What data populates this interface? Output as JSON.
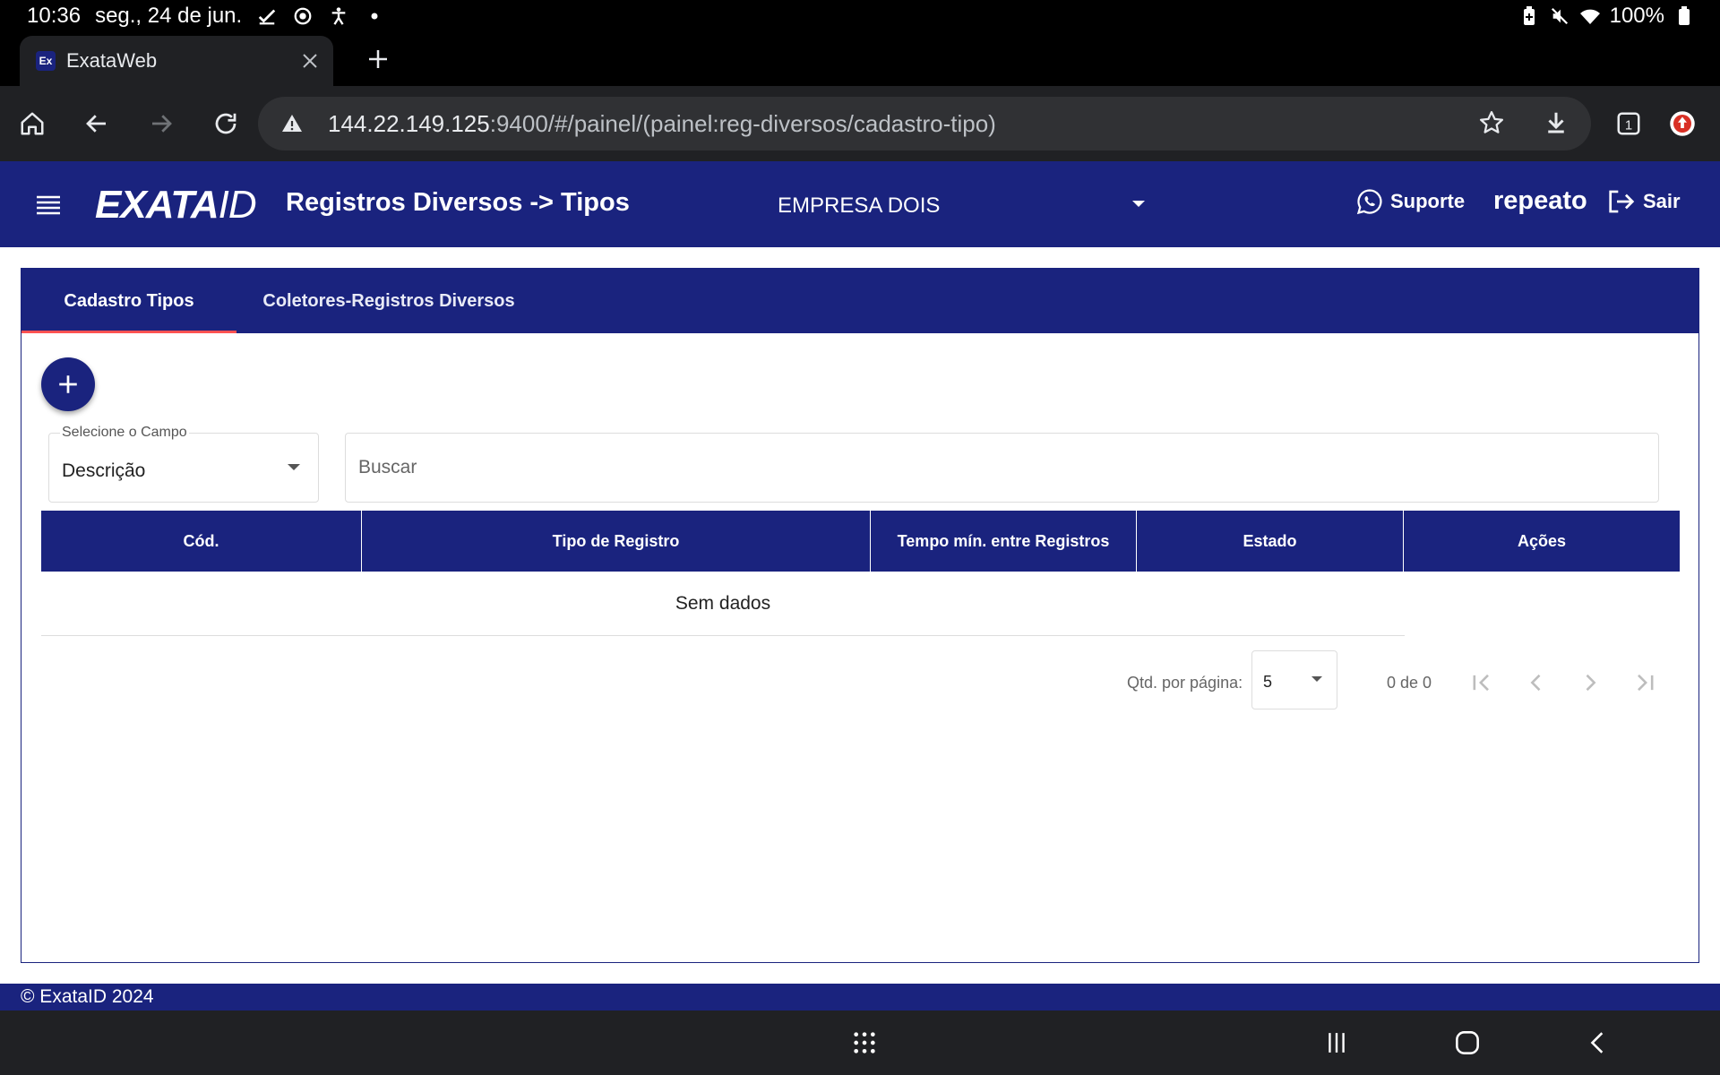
{
  "status_bar": {
    "time": "10:36",
    "date": "seg., 24 de jun.",
    "battery": "100%",
    "icons": [
      "check-icon",
      "radar-icon",
      "accessibility-icon",
      "dot-icon",
      "battery-saver-icon",
      "mute-icon",
      "wifi-icon",
      "battery-icon"
    ]
  },
  "browser": {
    "tab_title": "ExataWeb",
    "favicon_text": "Ex",
    "url_host": "144.22.149.125",
    "url_path": ":9400/#/painel/(painel:reg-diversos/cadastro-tipo)",
    "tab_count": "1"
  },
  "header": {
    "logo_text": "EXATA",
    "logo_suffix": "ID",
    "page_title": "Registros Diversos -> Tipos",
    "company": "EMPRESA DOIS",
    "support_label": "Suporte",
    "username": "repeato",
    "logout_label": "Sair"
  },
  "tabs": [
    {
      "label": "Cadastro Tipos",
      "active": true
    },
    {
      "label": "Coletores-Registros Diversos",
      "active": false
    }
  ],
  "filter": {
    "field_label": "Selecione o Campo",
    "field_value": "Descrição",
    "search_placeholder": "Buscar"
  },
  "table": {
    "columns": [
      "Cód.",
      "Tipo de Registro",
      "Tempo mín. entre Registros",
      "Estado",
      "Ações"
    ],
    "empty_message": "Sem dados"
  },
  "paginator": {
    "per_page_label": "Qtd. por página:",
    "per_page_value": "5",
    "range_label": "0 de 0"
  },
  "footer": {
    "copyright": "© ExataID 2024"
  },
  "colors": {
    "primary": "#1a237e",
    "tab_indicator": "#ff5252"
  }
}
